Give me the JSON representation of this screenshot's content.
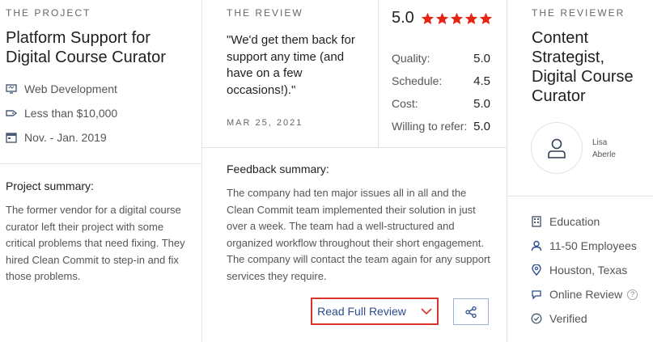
{
  "project": {
    "section_label": "THE PROJECT",
    "title": "Platform Support for Digital Course Curator",
    "service": "Web Development",
    "budget": "Less than $10,000",
    "dates": "Nov. - Jan. 2019",
    "summary_label": "Project summary:",
    "summary": "The former vendor for a digital course curator left their project with some critical problems that need fixing. They hired Clean Commit to step-in and fix those problems."
  },
  "review": {
    "section_label": "THE REVIEW",
    "quote": "\"We'd get them back for support any time (and have on a few occasions!).\"",
    "date": "MAR 25, 2021",
    "overall": "5.0",
    "stars": 5,
    "star_color": "#e62415",
    "scores": [
      {
        "label": "Quality:",
        "value": "5.0"
      },
      {
        "label": "Schedule:",
        "value": "4.5"
      },
      {
        "label": "Cost:",
        "value": "5.0"
      },
      {
        "label": "Willing to refer:",
        "value": "5.0"
      }
    ],
    "feedback_label": "Feedback summary:",
    "feedback": "The company had ten major issues all in all and the Clean Commit team implemented their solution in just over a week. The team had a well-structured and organized workflow throughout their short engagement. The company will contact the team again for any support services they require.",
    "read_full_label": "Read Full Review"
  },
  "reviewer": {
    "section_label": "THE REVIEWER",
    "title": "Content Strategist, Digital Course Curator",
    "first_name": "Lisa",
    "last_name": "Aberle",
    "industry": "Education",
    "employees": "11-50 Employees",
    "location": "Houston, Texas",
    "review_type": "Online Review",
    "help": "?",
    "verified": "Verified"
  },
  "colors": {
    "accent_red": "#d9342b",
    "link_blue": "#2b4c8f"
  }
}
